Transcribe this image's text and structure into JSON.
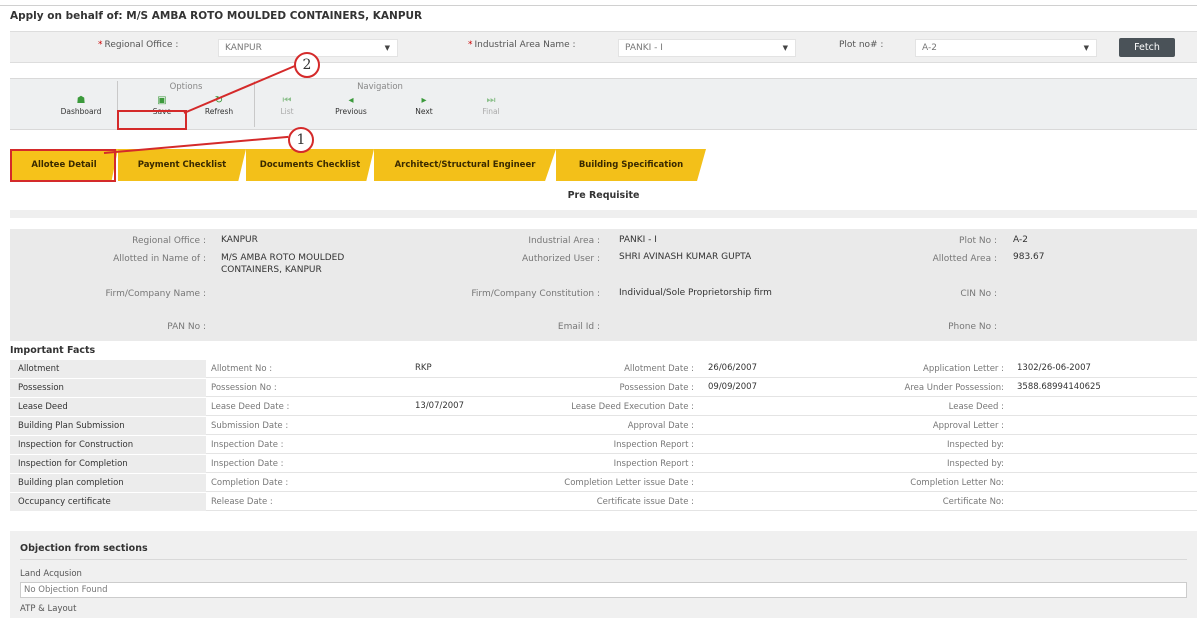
{
  "header": {
    "title": "Apply on behalf of: M/S AMBA ROTO MOULDED CONTAINERS, KANPUR"
  },
  "filters": {
    "regional_office": {
      "label": "Regional Office :",
      "value": "KANPUR"
    },
    "industrial_area": {
      "label": "Industrial Area Name :",
      "value": "PANKI - I"
    },
    "plot_no": {
      "label": "Plot no# :",
      "value": "A-2"
    },
    "fetch_label": "Fetch"
  },
  "toolbar": {
    "options_title": "Options",
    "navigation_title": "Navigation",
    "buttons": {
      "dashboard": "Dashboard",
      "save": "Save",
      "refresh": "Refresh",
      "list": "List",
      "previous": "Previous",
      "next": "Next",
      "final": "Final"
    }
  },
  "tabs": [
    "Allotee Detail",
    "Payment Checklist",
    "Documents Checklist",
    "Architect/Structural Engineer",
    "Building Specification"
  ],
  "annotations": {
    "one": "1",
    "two": "2"
  },
  "section_title": "Pre Requisite",
  "info": {
    "regional_office": {
      "label": "Regional Office :",
      "value": "KANPUR"
    },
    "industrial_area": {
      "label": "Industrial Area :",
      "value": "PANKI - I"
    },
    "plot_no": {
      "label": "Plot No :",
      "value": "A-2"
    },
    "allotted_name": {
      "label": "Allotted in Name of :",
      "value": "M/S AMBA ROTO MOULDED CONTAINERS, KANPUR"
    },
    "authorized_user": {
      "label": "Authorized User :",
      "value": "SHRI AVINASH KUMAR GUPTA"
    },
    "allotted_area": {
      "label": "Allotted Area :",
      "value": "983.67"
    },
    "firm_name": {
      "label": "Firm/Company Name :",
      "value": ""
    },
    "firm_constitution": {
      "label": "Firm/Company Constitution :",
      "value": "Individual/Sole Proprietorship firm"
    },
    "cin_no": {
      "label": "CIN No :",
      "value": ""
    },
    "pan_no": {
      "label": "PAN No :",
      "value": ""
    },
    "email": {
      "label": "Email Id :",
      "value": ""
    },
    "phone": {
      "label": "Phone No :",
      "value": ""
    }
  },
  "facts_title": "Important Facts",
  "facts": [
    {
      "name": "Allotment",
      "l1": "Allotment No :",
      "v1": "RKP",
      "l2": "Allotment Date :",
      "v2": "26/06/2007",
      "l3": "Application Letter :",
      "v3": "1302/26-06-2007"
    },
    {
      "name": "Possession",
      "l1": "Possession No :",
      "v1": "",
      "l2": "Possession Date :",
      "v2": "09/09/2007",
      "l3": "Area Under Possession:",
      "v3": "3588.68994140625"
    },
    {
      "name": "Lease Deed",
      "l1": "Lease Deed Date :",
      "v1": "13/07/2007",
      "l2": "Lease Deed Execution Date :",
      "v2": "",
      "l3": "Lease Deed :",
      "v3": ""
    },
    {
      "name": "Building Plan Submission",
      "l1": "Submission Date :",
      "v1": "",
      "l2": "Approval Date :",
      "v2": "",
      "l3": "Approval Letter :",
      "v3": ""
    },
    {
      "name": "Inspection for Construction",
      "l1": "Inspection Date :",
      "v1": "",
      "l2": "Inspection Report :",
      "v2": "",
      "l3": "Inspected by:",
      "v3": ""
    },
    {
      "name": "Inspection for Completion",
      "l1": "Inspection Date :",
      "v1": "",
      "l2": "Inspection Report :",
      "v2": "",
      "l3": "Inspected by:",
      "v3": ""
    },
    {
      "name": "Building plan completion",
      "l1": "Completion Date :",
      "v1": "",
      "l2": "Completion Letter issue Date :",
      "v2": "",
      "l3": "Completion Letter No:",
      "v3": ""
    },
    {
      "name": "Occupancy certificate",
      "l1": "Release Date :",
      "v1": "",
      "l2": "Certificate issue Date :",
      "v2": "",
      "l3": "Certificate No:",
      "v3": ""
    }
  ],
  "objection": {
    "title": "Objection from sections",
    "land_label": "Land Acqusion",
    "land_value": "No Objection Found",
    "atp_label": "ATP & Layout"
  },
  "colors": {
    "tab_yellow": "#f3c019",
    "annotation_red": "#d42a2a",
    "icon_green": "#3b9a3b",
    "fetch_bg": "#4a5258"
  }
}
